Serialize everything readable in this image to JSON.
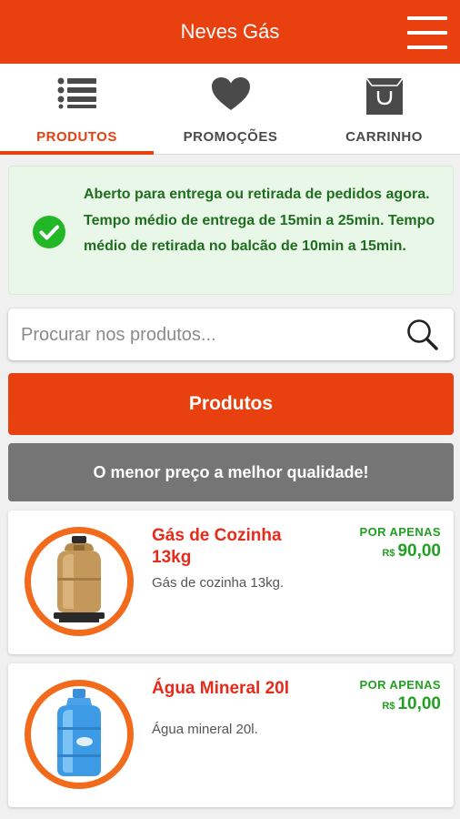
{
  "header": {
    "title": "Neves Gás"
  },
  "tabs": [
    {
      "label": "PRODUTOS",
      "icon": "list-icon",
      "active": true
    },
    {
      "label": "PROMOÇÕES",
      "icon": "heart-icon",
      "active": false
    },
    {
      "label": "CARRINHO",
      "icon": "shopping-bag-icon",
      "active": false
    }
  ],
  "notice": {
    "text": "Aberto para entrega ou retirada de pedidos agora. Tempo médio de entrega de 15min a 25min. Tempo médio de retirada no balcão de 10min a 15min.",
    "icon": "check-circle-icon"
  },
  "search": {
    "placeholder": "Procurar nos produtos...",
    "value": ""
  },
  "section_button": {
    "label": "Produtos"
  },
  "banner": {
    "text": "O menor preço a melhor qualidade!"
  },
  "products": [
    {
      "name": "Gás de Cozinha 13kg",
      "description": "Gás de cozinha 13kg.",
      "price_label": "POR APENAS",
      "currency": "R$",
      "price": "90,00",
      "image": "gas-cylinder-icon"
    },
    {
      "name": "Água Mineral 20l",
      "description": "Água mineral 20l.",
      "price_label": "POR APENAS",
      "currency": "R$",
      "price": "10,00",
      "image": "water-gallon-icon"
    }
  ],
  "colors": {
    "primary": "#e8410f",
    "banner_gray": "#757575",
    "price_green": "#21a021",
    "product_name_red": "#e52b1a",
    "notice_bg": "#e9f7e9"
  }
}
